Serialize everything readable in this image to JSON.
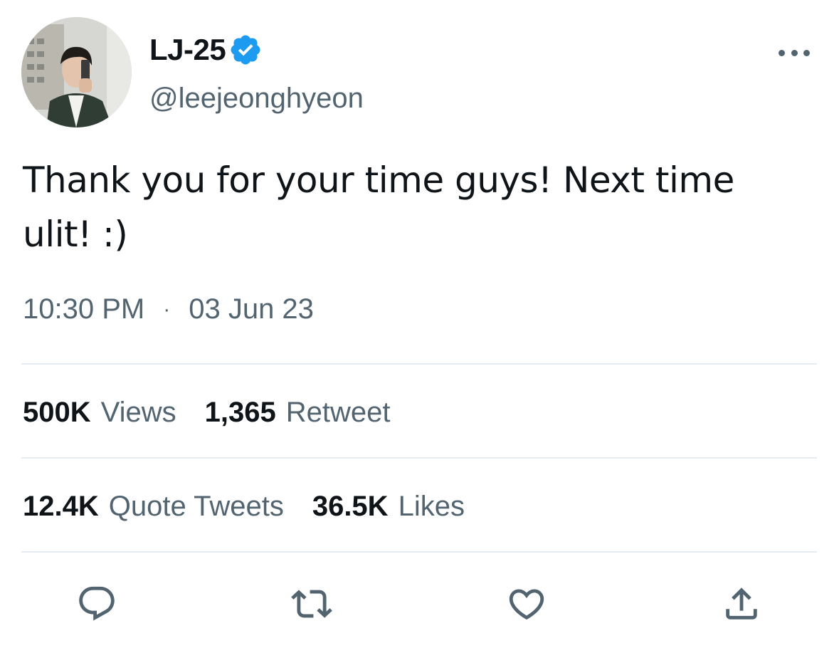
{
  "user": {
    "display_name": "LJ-25",
    "handle": "@leejeonghyeon",
    "verified": true
  },
  "tweet": {
    "text_line1": "Thank you for your time guys! Next time",
    "text_line2": "ulit! :)",
    "time": "10:30 PM",
    "separator": "·",
    "date": "03 Jun 23"
  },
  "stats": {
    "views_count": "500K",
    "views_label": "Views",
    "retweet_count": "1,365",
    "retweet_label": "Retweet",
    "quote_count": "12.4K",
    "quote_label": "Quote Tweets",
    "likes_count": "36.5K",
    "likes_label": "Likes"
  },
  "icons": {
    "reply": "reply-icon",
    "retweet": "retweet-icon",
    "like": "heart-icon",
    "share": "share-icon",
    "more": "more-horizontal-icon",
    "verified": "verified-badge-icon"
  },
  "colors": {
    "text_primary": "#0f1419",
    "text_secondary": "#536471",
    "verified_blue": "#1d9bf0",
    "divider": "#e6ecf0"
  }
}
